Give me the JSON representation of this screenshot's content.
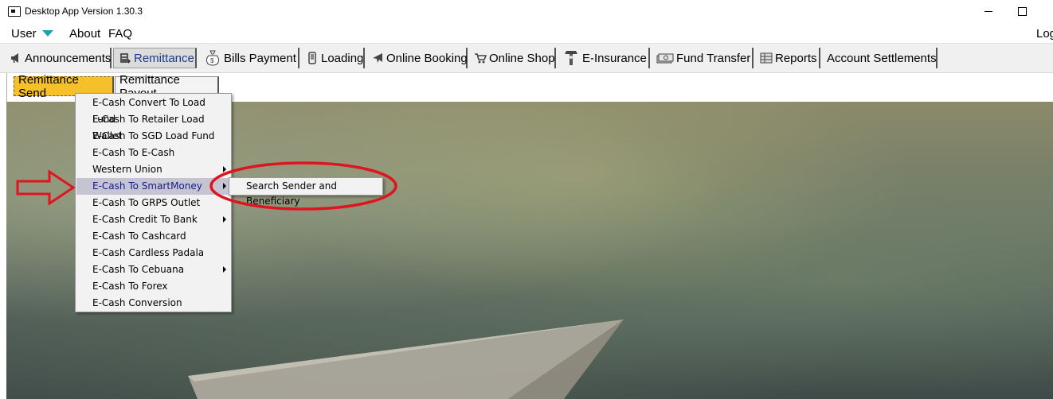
{
  "window": {
    "title": "Desktop App Version 1.30.3"
  },
  "menubar": {
    "user": "User",
    "about": "About",
    "faq": "FAQ",
    "logout_partial": "Log"
  },
  "tabs": [
    {
      "label": "Announcements",
      "icon": "megaphone-icon"
    },
    {
      "label": "Remittance",
      "icon": "remittance-icon"
    },
    {
      "label": "Bills Payment",
      "icon": "money-bag-icon"
    },
    {
      "label": "Loading",
      "icon": "mobile-phone-icon"
    },
    {
      "label": "Online Booking",
      "icon": "airplane-icon"
    },
    {
      "label": "Online Shop",
      "icon": "shopping-cart-icon"
    },
    {
      "label": "E-Insurance",
      "icon": "insurance-icon"
    },
    {
      "label": "Fund Transfer",
      "icon": "cash-stack-icon"
    },
    {
      "label": "Reports",
      "icon": "report-icon"
    },
    {
      "label": "Account Settlements",
      "icon": ""
    }
  ],
  "subtabs": {
    "send": "Remittance Send",
    "payout": "Remittance Payout"
  },
  "dropdown": {
    "items": [
      {
        "label": "E-Cash Convert To Load Fund"
      },
      {
        "label": "E-Cash To Retailer Load Wallet"
      },
      {
        "label": "E-Cash To SGD Load Fund"
      },
      {
        "label": "E-Cash To E-Cash"
      },
      {
        "label": "Western Union"
      },
      {
        "label": "E-Cash To SmartMoney"
      },
      {
        "label": "E-Cash To GRPS Outlet"
      },
      {
        "label": "E-Cash Credit To Bank"
      },
      {
        "label": "E-Cash To Cashcard"
      },
      {
        "label": "E-Cash Cardless Padala"
      },
      {
        "label": "E-Cash To Cebuana"
      },
      {
        "label": "E-Cash To Forex"
      },
      {
        "label": "E-Cash Conversion"
      }
    ]
  },
  "submenu": {
    "item": "Search Sender and Beneficiary"
  },
  "colors": {
    "active_subtab": "#f5c02a",
    "menu_highlight": "#c4c4d2",
    "annotation_red": "#e0141e",
    "dropdown_indicator": "#1aa0b6"
  }
}
